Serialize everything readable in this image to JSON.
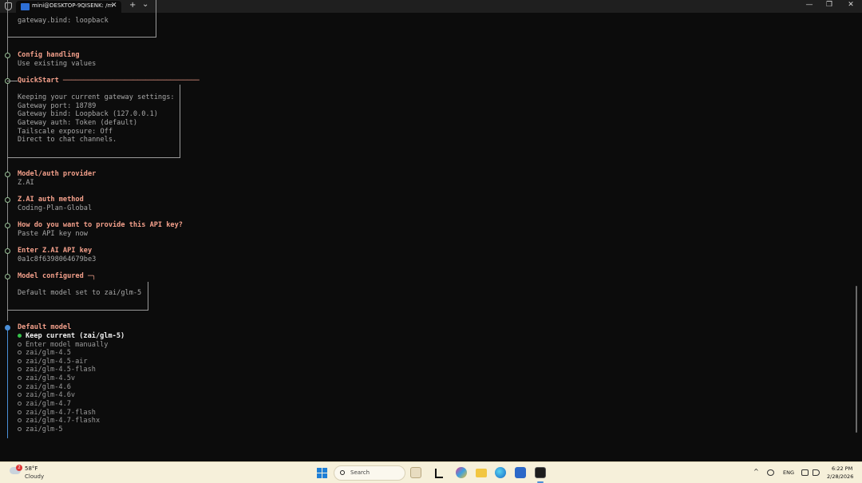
{
  "window": {
    "tab_title": "mini@DESKTOP-9QISENK: /m",
    "tab_close": "✕",
    "new_tab": "+",
    "dropdown": "⌄",
    "minimize": "—",
    "maximize": "❐",
    "close": "✕"
  },
  "terminal": {
    "top_box_line": "gateway.bind: loopback",
    "sections": [
      {
        "title": "Config handling",
        "value": "Use existing values"
      },
      {
        "title": "QuickStart",
        "suffix": " ─────────────────────────────────"
      },
      {
        "title": "Model/auth provider",
        "value": "Z.AI"
      },
      {
        "title": "Z.AI auth method",
        "value": "Coding-Plan-Global"
      },
      {
        "title": "How do you want to provide this API key?",
        "value": "Paste API key now"
      },
      {
        "title": "Enter Z.AI API key",
        "value": "0a1c8f6398064679be3"
      },
      {
        "title": "Model configured",
        "suffix": " ─╮"
      },
      {
        "title": "Default model"
      }
    ],
    "quickstart_lines": [
      "Keeping your current gateway settings:",
      "Gateway port: 18789",
      "Gateway bind: Loopback (127.0.0.1)",
      "Gateway auth: Token (default)",
      "Tailscale exposure: Off",
      "Direct to chat channels."
    ],
    "model_configured_line": "Default model set to zai/glm-5",
    "options": [
      {
        "label": "Keep current (zai/glm-5)",
        "selected": true
      },
      {
        "label": "Enter model manually",
        "selected": false
      },
      {
        "label": "zai/glm-4.5",
        "selected": false
      },
      {
        "label": "zai/glm-4.5-air",
        "selected": false
      },
      {
        "label": "zai/glm-4.5-flash",
        "selected": false
      },
      {
        "label": "zai/glm-4.5v",
        "selected": false
      },
      {
        "label": "zai/glm-4.6",
        "selected": false
      },
      {
        "label": "zai/glm-4.6v",
        "selected": false
      },
      {
        "label": "zai/glm-4.7",
        "selected": false
      },
      {
        "label": "zai/glm-4.7-flash",
        "selected": false
      },
      {
        "label": "zai/glm-4.7-flashx",
        "selected": false
      },
      {
        "label": "zai/glm-5",
        "selected": false
      }
    ]
  },
  "taskbar": {
    "weather_badge": "2",
    "temperature": "58°F",
    "condition": "Cloudy",
    "search_placeholder": "Search",
    "language": "ENG",
    "time": "6:22 PM",
    "date": "2/28/2026"
  },
  "colors": {
    "heading": "#f4a08b",
    "gutter_active": "#4a8fd8",
    "selected_radio": "#35c24a",
    "taskbar_bg": "#f6f0da"
  }
}
